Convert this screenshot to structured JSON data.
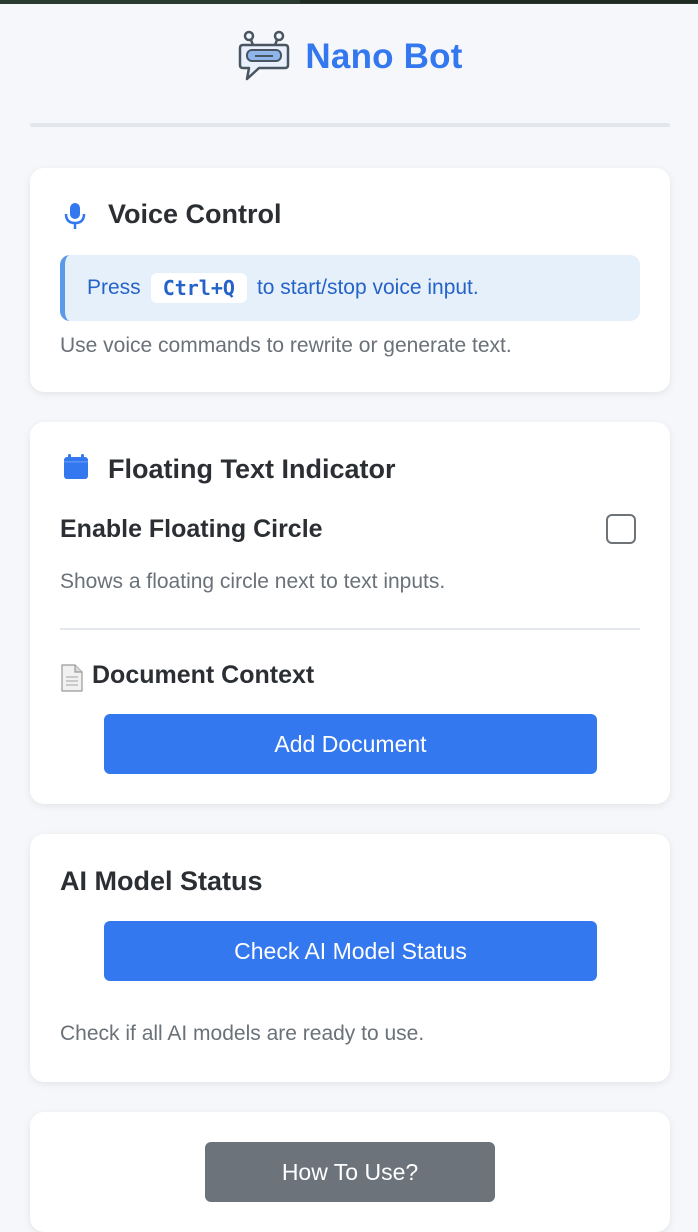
{
  "header": {
    "title": "Nano Bot",
    "logo_icon": "robot-chat-icon"
  },
  "colors": {
    "accent": "#3478f0",
    "hint_bg": "#e6f0fb",
    "hint_text": "#2563c9",
    "secondary_button": "#6c737b"
  },
  "voice_control": {
    "icon": "microphone-icon",
    "title": "Voice Control",
    "hint_prefix": "Press",
    "hint_shortcut": "Ctrl+Q",
    "hint_suffix": "to start/stop voice input.",
    "description": "Use voice commands to rewrite or generate text."
  },
  "floating_indicator": {
    "icon": "calendar-icon",
    "title": "Floating Text Indicator",
    "enable_label": "Enable Floating Circle",
    "enabled": false,
    "description": "Shows a floating circle next to text inputs.",
    "document_context": {
      "icon": "document-icon",
      "title": "Document Context",
      "add_button": "Add Document"
    }
  },
  "ai_status": {
    "title": "AI Model Status",
    "check_button": "Check AI Model Status",
    "description": "Check if all AI models are ready to use."
  },
  "help": {
    "how_to_button": "How To Use?"
  }
}
